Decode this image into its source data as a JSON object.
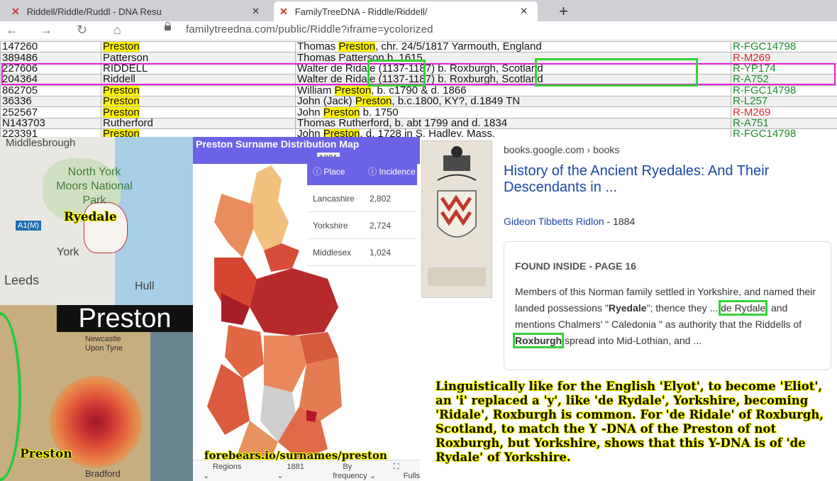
{
  "browser": {
    "tabs": [
      {
        "title": "Riddell/Riddle/Ruddl - DNA Resu",
        "close": "✕"
      },
      {
        "title": "FamilyTreeDNA - Riddle/Riddell/",
        "close": "✕"
      }
    ],
    "new_tab": "+",
    "url": "familytreedna.com/public/Riddle?iframe=ycolorized"
  },
  "table": {
    "rows": [
      {
        "kit": "147260",
        "name": "Preston",
        "ancestor_pre": "Thomas ",
        "ancestor_hl": "Preston",
        "ancestor_post": ", chr. 24/5/1817 Yarmouth, England",
        "hg": "R-FGC14798",
        "hg_color": "green",
        "name_hl": true
      },
      {
        "kit": "389486",
        "name": "Patterson",
        "ancestor_pre": "Thomas Patterson b. 1615",
        "ancestor_hl": "",
        "ancestor_post": "",
        "hg": "R-M269",
        "hg_color": "red",
        "name_hl": false
      },
      {
        "kit": "227606",
        "name": "RIDDELL",
        "ancestor_pre": "Walter de Ridale (1137-1187) b. Roxburgh, Scotland",
        "ancestor_hl": "",
        "ancestor_post": "",
        "hg": "R-YP174",
        "hg_color": "green",
        "name_hl": false
      },
      {
        "kit": "204364",
        "name": "Riddell",
        "ancestor_pre": "Walter de Ridale (1137-1187) b. Roxburgh, Scotland",
        "ancestor_hl": "",
        "ancestor_post": "",
        "hg": "R-A752",
        "hg_color": "green",
        "name_hl": false
      },
      {
        "kit": "862705",
        "name": "Preston",
        "ancestor_pre": "William ",
        "ancestor_hl": "Preston",
        "ancestor_post": ", b. c1790 & d. 1866",
        "hg": "R-FGC14798",
        "hg_color": "green",
        "name_hl": true
      },
      {
        "kit": "36336",
        "name": "Preston",
        "ancestor_pre": "John (Jack) ",
        "ancestor_hl": "Preston",
        "ancestor_post": ", b.c.1800, KY?, d.1849 TN",
        "hg": "R-L257",
        "hg_color": "green",
        "name_hl": true
      },
      {
        "kit": "252567",
        "name": "Preston",
        "ancestor_pre": "John ",
        "ancestor_hl": "Preston",
        "ancestor_post": " b. 1750",
        "hg": "R-M269",
        "hg_color": "red",
        "name_hl": true
      },
      {
        "kit": "N143703",
        "name": "Rutherford",
        "ancestor_pre": "Thomas Rutherford, b. abt 1799 and d. 1834",
        "ancestor_hl": "",
        "ancestor_post": "",
        "hg": "R-A751",
        "hg_color": "green",
        "name_hl": false
      },
      {
        "kit": "223391",
        "name": "Preston",
        "ancestor_pre": "John ",
        "ancestor_hl": "Preston",
        "ancestor_post": ", d. 1728 in S. Hadley, Mass.",
        "hg": "R-FGC14798",
        "hg_color": "green",
        "name_hl": true
      }
    ]
  },
  "map1": {
    "labels": {
      "middlesbrough": "Middlesbrough",
      "north_york_moors": "North York Moors National Park",
      "ryedale": "Ryedale",
      "york": "York",
      "leeds": "Leeds",
      "hull": "Hull",
      "a1m": "A1(M)"
    }
  },
  "map2": {
    "title": "Preston",
    "newcastle": "Newcastle Upon Tyne",
    "preston_label": "Preston",
    "bradford": "Bradford"
  },
  "distribution": {
    "title": "Preston Surname Distribution Map",
    "year": "1881",
    "col_place": "Place",
    "col_incidence": "Incidence",
    "rows": [
      {
        "place": "Lancashire",
        "incidence": "2,802"
      },
      {
        "place": "Yorkshire",
        "incidence": "2,724"
      },
      {
        "place": "Middlesex",
        "incidence": "1,024"
      }
    ],
    "footer": {
      "regions": "Regions",
      "year": "1881",
      "sort": "By frequency",
      "fullscreen": "Fulls"
    },
    "source": "forebears.io/surnames/preston"
  },
  "books": {
    "source": "books.google.com › books",
    "title": "History of the Ancient Ryedales: And Their Descendants in ...",
    "author": "Gideon Tibbetts Ridlon",
    "year": " - 1884",
    "found_inside": "FOUND INSIDE - PAGE 16",
    "snippet_1": "Members of this Norman family settled in Yorkshire, and named their landed possessions \"",
    "snippet_ryedale": "Ryedale",
    "snippet_2": "\"; thence they ... ",
    "snippet_derydale": "de Rydale",
    "snippet_3": ", and mentions Chalmers' \" Caledonia \" as authority that the Riddells of ",
    "snippet_roxburgh": "Roxburgh",
    "snippet_4": " spread into Mid-Lothian, and ..."
  },
  "explanation": "Linguistically like for the English 'Elyot', to become 'Eliot', an 'i' replaced a 'y', like 'de Rydale', Yorkshire, becoming 'Ridale', Roxburgh is common. For 'de Ridale' of Roxburgh, Scotland, to match the Y -DNA of the Preston of not Roxburgh, but Yorkshire, shows that this Y-DNA is of 'de Rydale' of Yorkshire."
}
